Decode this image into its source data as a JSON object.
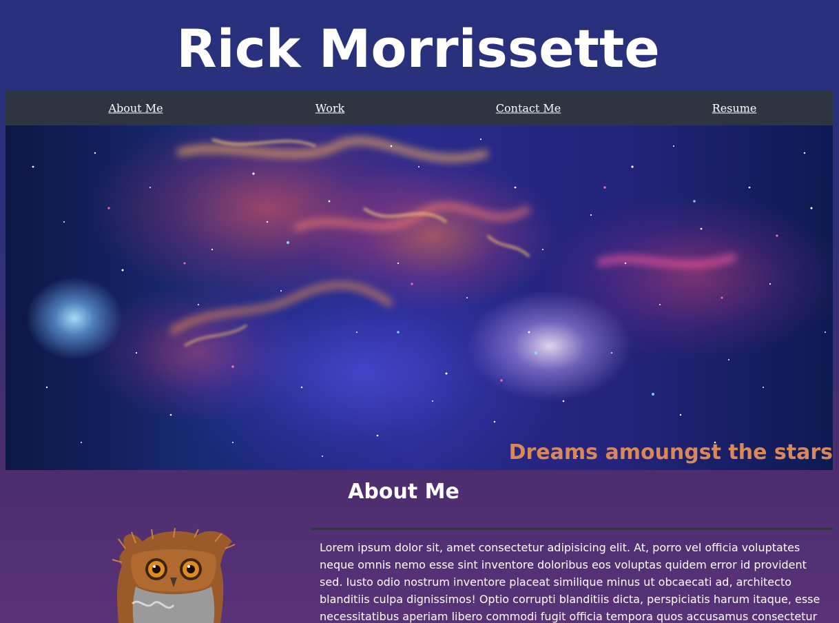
{
  "site": {
    "title": "Rick Morrissette"
  },
  "nav": {
    "items": [
      {
        "label": "About Me"
      },
      {
        "label": "Work"
      },
      {
        "label": "Contact Me"
      },
      {
        "label": "Resume"
      }
    ]
  },
  "hero": {
    "caption": "Dreams amoungst the stars"
  },
  "about": {
    "heading": "About Me",
    "text": "Lorem ipsum dolor sit, amet consectetur adipisicing elit. At, porro vel officia voluptates neque omnis nemo esse sint inventore doloribus eos voluptas quidem error id provident sed. Iusto odio nostrum inventore placeat similique minus ut obcaecati ad, architecto blanditiis culpa dignissimos! Optio corrupti blanditiis dicta, perspiciatis harum itaque, esse necessitatibus aperiam libero commodi fugit officia tempora quos accusamus consectetur totam dolorum"
  },
  "colors": {
    "header_bg": "#27307e",
    "nav_bg": "#2e3541",
    "caption": "#d9885a"
  }
}
